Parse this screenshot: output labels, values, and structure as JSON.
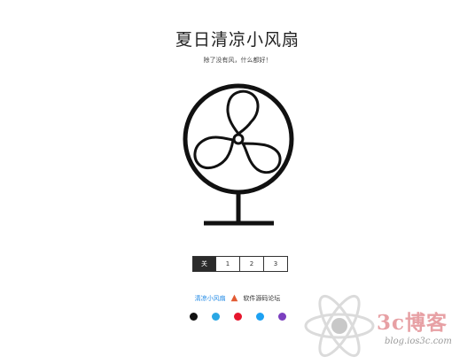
{
  "page": {
    "title": "夏日清凉小风扇",
    "subtitle": "除了没有风，什么都好！"
  },
  "speed_buttons": [
    {
      "label": "关",
      "active": true
    },
    {
      "label": "1",
      "active": false
    },
    {
      "label": "2",
      "active": false
    },
    {
      "label": "3",
      "active": false
    }
  ],
  "footer": {
    "link_label": "清凉小风扇",
    "separator_icon": "flame-icon",
    "text": "软件源码论坛"
  },
  "social": [
    {
      "icon": "github-icon",
      "color": "#111111"
    },
    {
      "icon": "qq-icon",
      "color": "#2aa7e4"
    },
    {
      "icon": "weibo-icon",
      "color": "#e6162d"
    },
    {
      "icon": "twitter-icon",
      "color": "#1da1f2"
    },
    {
      "icon": "gitee-icon",
      "color": "#7b3fbf"
    }
  ],
  "watermark": {
    "title": "3c博客",
    "url": "blog.ios3c.com"
  }
}
